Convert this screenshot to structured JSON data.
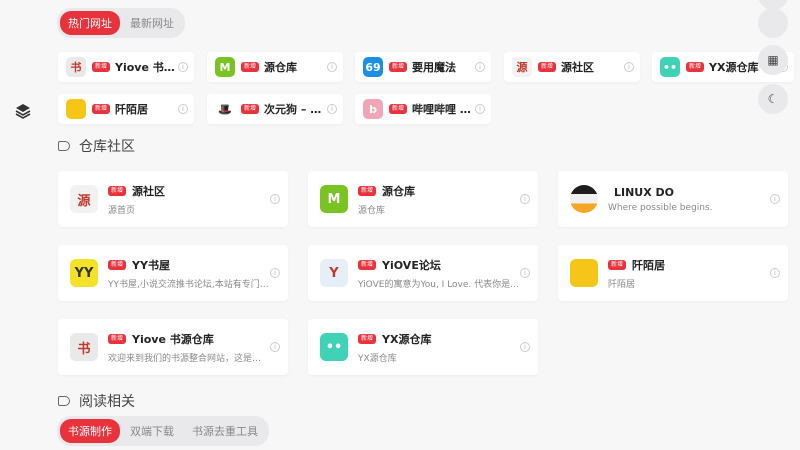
{
  "top_tabs": [
    {
      "label": "热门网址"
    },
    {
      "label": "最新网址"
    }
  ],
  "hot_links": [
    {
      "name": "Yiove 书源仓库",
      "badge": "新增",
      "icon": "book-icon",
      "color": "#e9e9e9",
      "glyph": "书"
    },
    {
      "name": "源仓库",
      "badge": "新增",
      "icon": "m-logo-icon",
      "color": "#79c322",
      "glyph": "M"
    },
    {
      "name": "要用魔法",
      "badge": "新增",
      "icon": "69-logo-icon",
      "color": "#1c8ee6",
      "glyph": "69"
    },
    {
      "name": "源社区",
      "badge": "新增",
      "icon": "community-logo-icon",
      "color": "#f2f2f2",
      "glyph": "源"
    },
    {
      "name": "YX源仓库",
      "badge": "新增",
      "icon": "ghost-icon",
      "color": "#3fd2b6",
      "glyph": "••"
    },
    {
      "name": "阡陌居",
      "badge": "新增",
      "icon": "folder-icon",
      "color": "#f5c518",
      "glyph": ""
    },
    {
      "name": "次元狗 – 动漫资源站",
      "badge": "新增",
      "icon": "hat-icon",
      "color": "#ffffff",
      "glyph": "🎩"
    },
    {
      "name": "哔哩哔哩 (゜",
      "badge": "新增",
      "icon": "bilibili-icon",
      "color": "#f1a6b5",
      "glyph": "b"
    }
  ],
  "section_community": {
    "title": "仓库社区"
  },
  "community_cards": [
    {
      "name": "源社区",
      "badge": "新增",
      "desc": "源首页",
      "icon": "community-logo-icon",
      "color": "#f2f2f2",
      "glyph": "源"
    },
    {
      "name": "源仓库",
      "badge": "新增",
      "desc": "源仓库",
      "icon": "m-logo-icon",
      "color": "#79c322",
      "glyph": "M"
    },
    {
      "name": "LINUX DO",
      "badge": "",
      "desc": "Where possible begins.",
      "icon": "linuxdo-icon",
      "color": "#1d1d1d",
      "glyph": ""
    },
    {
      "name": "YY书屋",
      "badge": "新增",
      "desc": "YY书屋,小说交流推书论坛,本站有专门的资源分享区",
      "icon": "yy-logo-icon",
      "color": "#f3e12a",
      "glyph": "YY"
    },
    {
      "name": "YiOVE论坛",
      "badge": "新增",
      "desc": "YiOVE的寓意为You, I Love. 代表你是我的所爱",
      "icon": "yiove-logo-icon",
      "color": "#e6eef8",
      "glyph": "Y"
    },
    {
      "name": "阡陌居",
      "badge": "新增",
      "desc": "阡陌居",
      "icon": "folder-icon",
      "color": "#f5c518",
      "glyph": ""
    },
    {
      "name": "Yiove 书源仓库",
      "badge": "新增",
      "desc": "欢迎来到我们的书源整合网站，这是一个专注于书源的平台",
      "icon": "book-icon",
      "color": "#e9e9e9",
      "glyph": "书"
    },
    {
      "name": "YX源仓库",
      "badge": "新增",
      "desc": "YX源仓库",
      "icon": "ghost-icon",
      "color": "#3fd2b6",
      "glyph": "••"
    }
  ],
  "section_reading": {
    "title": "阅读相关"
  },
  "reading_tabs": [
    {
      "label": "书源制作"
    },
    {
      "label": "双端下载"
    },
    {
      "label": "书源去重工具"
    }
  ],
  "info_glyph": "i",
  "side_buttons": [
    {
      "icon": "blank-icon",
      "glyph": ""
    },
    {
      "icon": "blank-icon",
      "glyph": ""
    },
    {
      "icon": "calculator-icon",
      "glyph": "▦"
    },
    {
      "icon": "moon-icon",
      "glyph": "☾"
    }
  ],
  "colors": {
    "accent": "#e8333c",
    "background": "#f7f7f8",
    "card": "#ffffff"
  }
}
